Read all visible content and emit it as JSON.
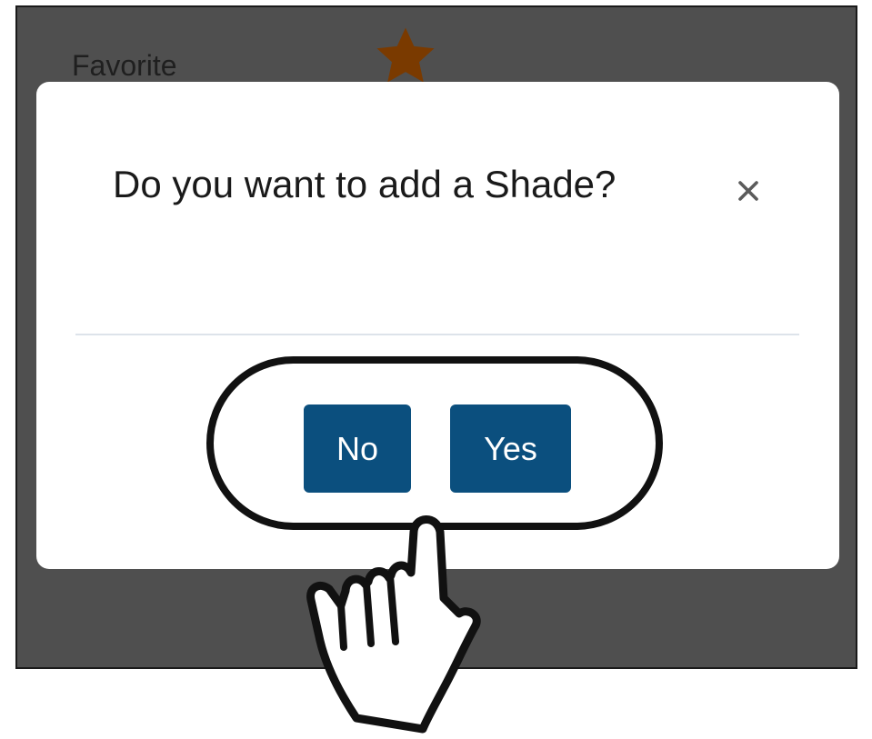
{
  "background": {
    "label": "Favorite",
    "star_icon": "star-icon",
    "star_color": "#7a3a00"
  },
  "dialog": {
    "title": "Do you want to add a Shade?",
    "close_glyph": "×",
    "close_icon": "close-icon"
  },
  "actions": {
    "no_label": "No",
    "yes_label": "Yes"
  },
  "annotation": {
    "highlight": "rounded-outline",
    "pointer_icon": "pointing-hand-icon"
  },
  "colors": {
    "overlay": "#4f4f4f",
    "button": "#0b4f7e",
    "button_text": "#ffffff",
    "title_text": "#1a1a1a",
    "divider": "#dde3ea"
  }
}
